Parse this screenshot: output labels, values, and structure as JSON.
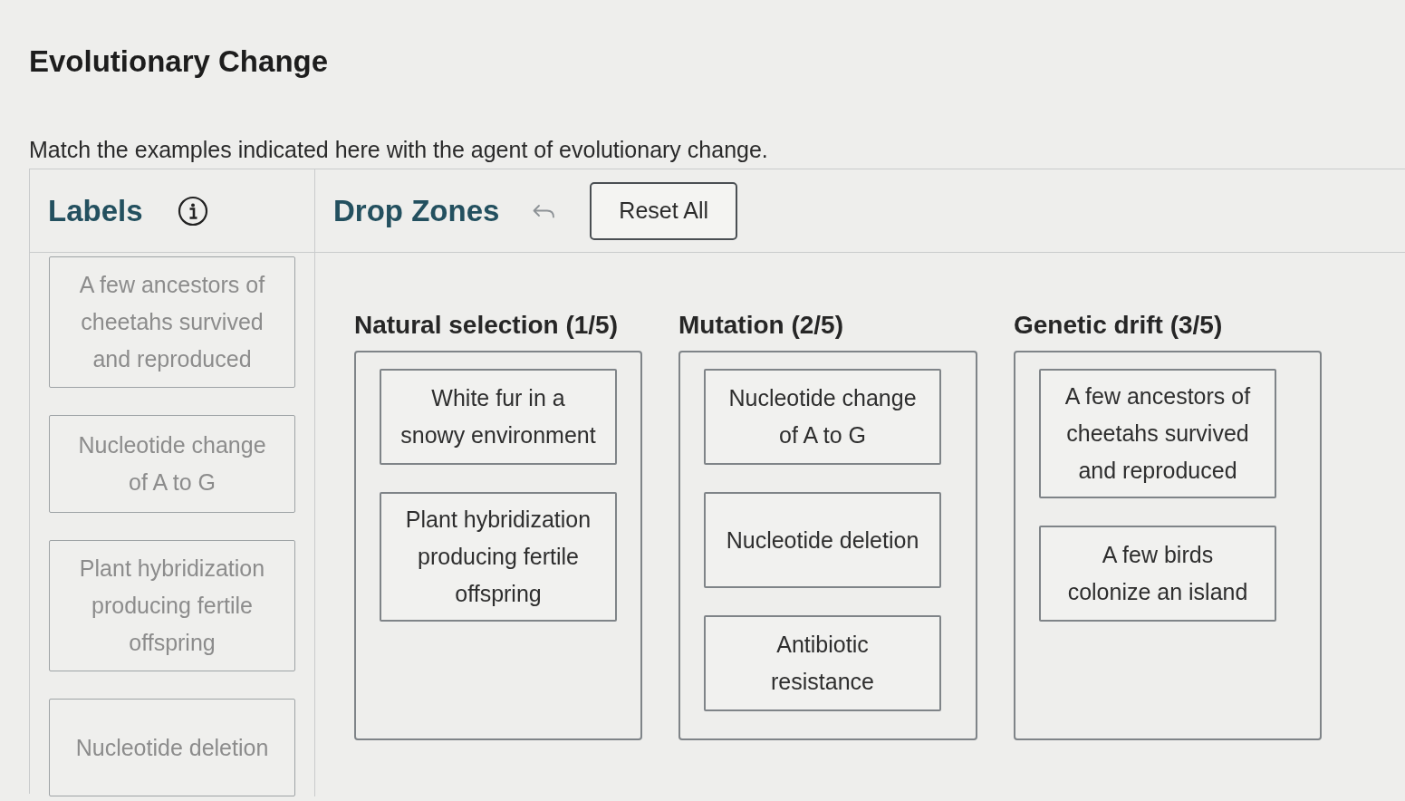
{
  "title": "Evolutionary Change",
  "instructions": "Match the examples indicated here with the agent of evolutionary change.",
  "labels_panel": {
    "heading": "Labels",
    "items": [
      {
        "text": "A few ancestors of cheetahs survived and reproduced",
        "placed": true
      },
      {
        "text": "Nucleotide change of A to G",
        "placed": true
      },
      {
        "text": "Plant hybridization producing fertile offspring",
        "placed": true
      },
      {
        "text": "Nucleotide deletion",
        "placed": true
      }
    ]
  },
  "drop_panel": {
    "heading": "Drop Zones",
    "reset_button": "Reset All",
    "zones": [
      {
        "heading": "Natural selection (1/5)",
        "items": [
          "White fur in a snowy environment",
          "Plant hybridization producing fertile offspring"
        ]
      },
      {
        "heading": "Mutation (2/5)",
        "items": [
          "Nucleotide change of A to G",
          "Nucleotide deletion",
          "Antibiotic resistance"
        ]
      },
      {
        "heading": "Genetic drift (3/5)",
        "items": [
          "A few ancestors of cheetahs survived and reproduced",
          "A few birds colonize an island"
        ]
      }
    ]
  }
}
